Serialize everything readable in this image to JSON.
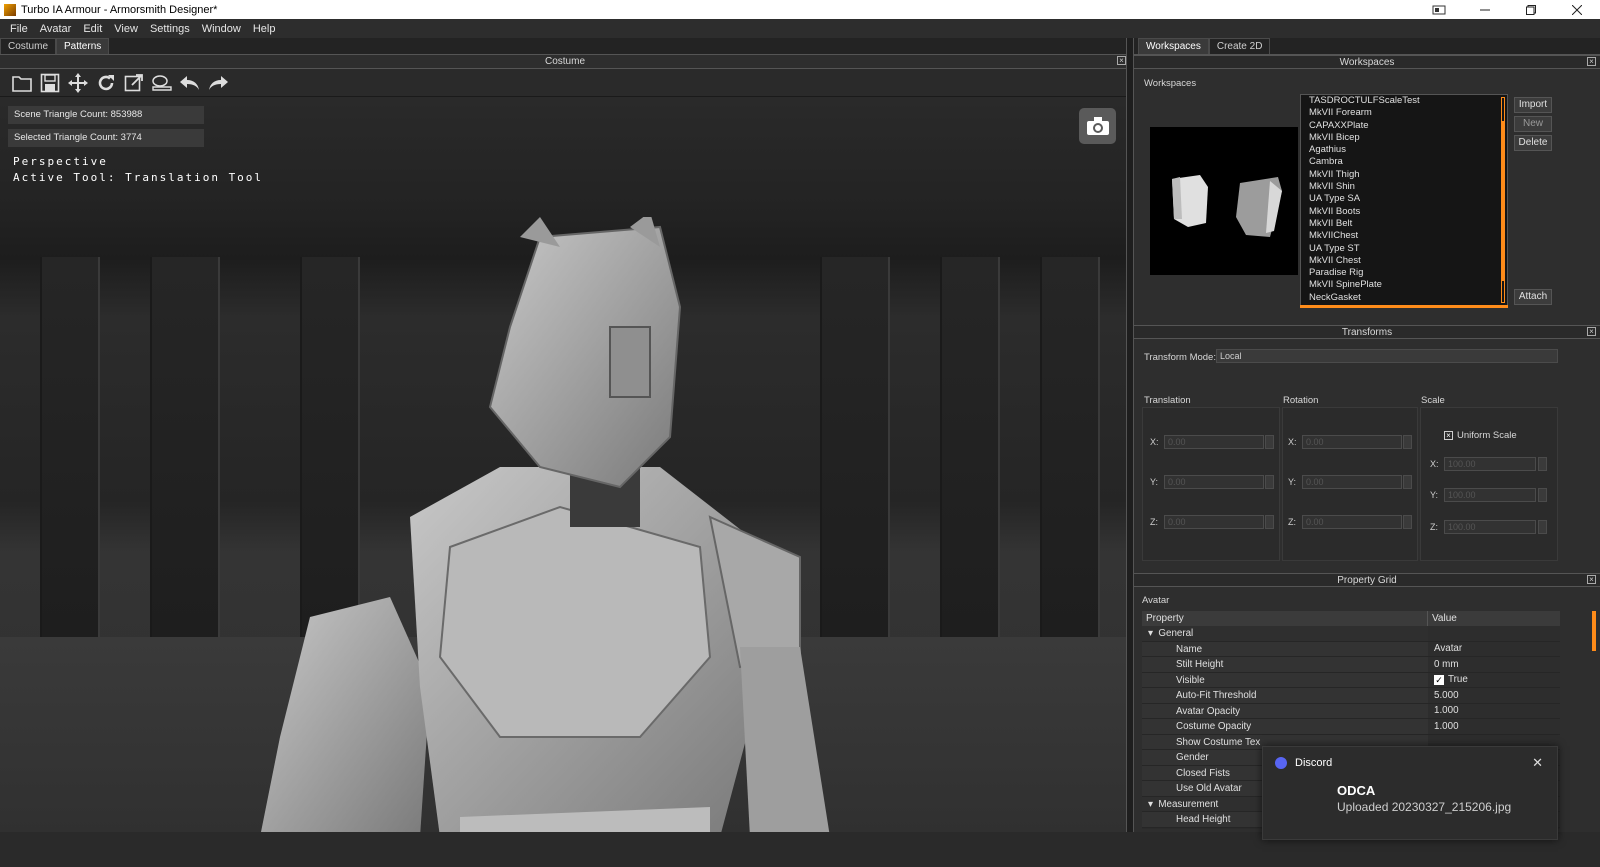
{
  "window": {
    "title": "Turbo IA Armour - Armorsmith Designer*",
    "controls": [
      "restore-down",
      "minimize",
      "maximize",
      "close"
    ]
  },
  "menu": [
    "File",
    "Avatar",
    "Edit",
    "View",
    "Settings",
    "Window",
    "Help"
  ],
  "left_tabs": [
    "Costume",
    "Patterns"
  ],
  "costume_panel": {
    "header": "Costume",
    "toolbar_icons": [
      "open-folder-icon",
      "save-icon",
      "move-icon",
      "rotate-icon",
      "scale-icon",
      "stamp-icon",
      "undo-icon",
      "redo-icon"
    ]
  },
  "viewport": {
    "scene_triangle_count": "Scene Triangle Count: 853988",
    "selected_triangle_count": "Selected Triangle Count: 3774",
    "view_mode": "Perspective",
    "active_tool": "Active Tool: Translation Tool"
  },
  "right_tabs": [
    "Workspaces",
    "Create 2D"
  ],
  "workspaces": {
    "header": "Workspaces",
    "label": "Workspaces",
    "items": [
      "TASDROCTULFScaleTest",
      "MkVII Forearm",
      "CAPAXXPlate",
      "MkVII Bicep",
      "Agathius",
      "Cambra",
      "MkVII Thigh",
      "MkVII Shin",
      "UA Type SA",
      "MkVII Boots",
      "MkVII Belt",
      "MkVIIChest",
      "UA Type ST",
      "MkVII Chest",
      "Paradise Rig",
      "MkVII SpinePlate",
      "NeckGasket"
    ],
    "buttons": {
      "import": "Import",
      "new": "New",
      "delete": "Delete",
      "attach": "Attach"
    }
  },
  "transforms": {
    "header": "Transforms",
    "mode_label": "Transform Mode:",
    "mode_value": "Local",
    "translation_label": "Translation",
    "rotation_label": "Rotation",
    "scale_label": "Scale",
    "uniform_scale": "Uniform Scale",
    "axes": {
      "x": "X:",
      "y": "Y:",
      "z": "Z:"
    },
    "translation_values": {
      "x": "0.00",
      "y": "0.00",
      "z": "0.00"
    },
    "rotation_values": {
      "x": "0.00",
      "y": "0.00",
      "z": "0.00"
    },
    "scale_values": {
      "x": "100.00",
      "y": "100.00",
      "z": "100.00"
    }
  },
  "property_grid": {
    "header": "Property Grid",
    "object": "Avatar",
    "col_property": "Property",
    "col_value": "Value",
    "general": "General",
    "rows": [
      {
        "name": "Name",
        "value": "Avatar"
      },
      {
        "name": "Stilt Height",
        "value": "0 mm"
      },
      {
        "name": "Visible",
        "value": "True"
      },
      {
        "name": "Auto-Fit Threshold",
        "value": "5.000"
      },
      {
        "name": "Avatar Opacity",
        "value": "1.000"
      },
      {
        "name": "Costume Opacity",
        "value": "1.000"
      },
      {
        "name": "Show Costume Tex",
        "value": ""
      },
      {
        "name": "Gender",
        "value": ""
      },
      {
        "name": "Closed Fists",
        "value": ""
      },
      {
        "name": "Use Old Avatar",
        "value": ""
      }
    ],
    "measurement": "Measurement",
    "last_row": "Head Height"
  },
  "notification": {
    "app": "Discord",
    "title": "ODCA",
    "body": "Uploaded 20230327_215206.jpg"
  },
  "colors": {
    "accent": "#ff8c1a",
    "discord": "#5865f2"
  }
}
